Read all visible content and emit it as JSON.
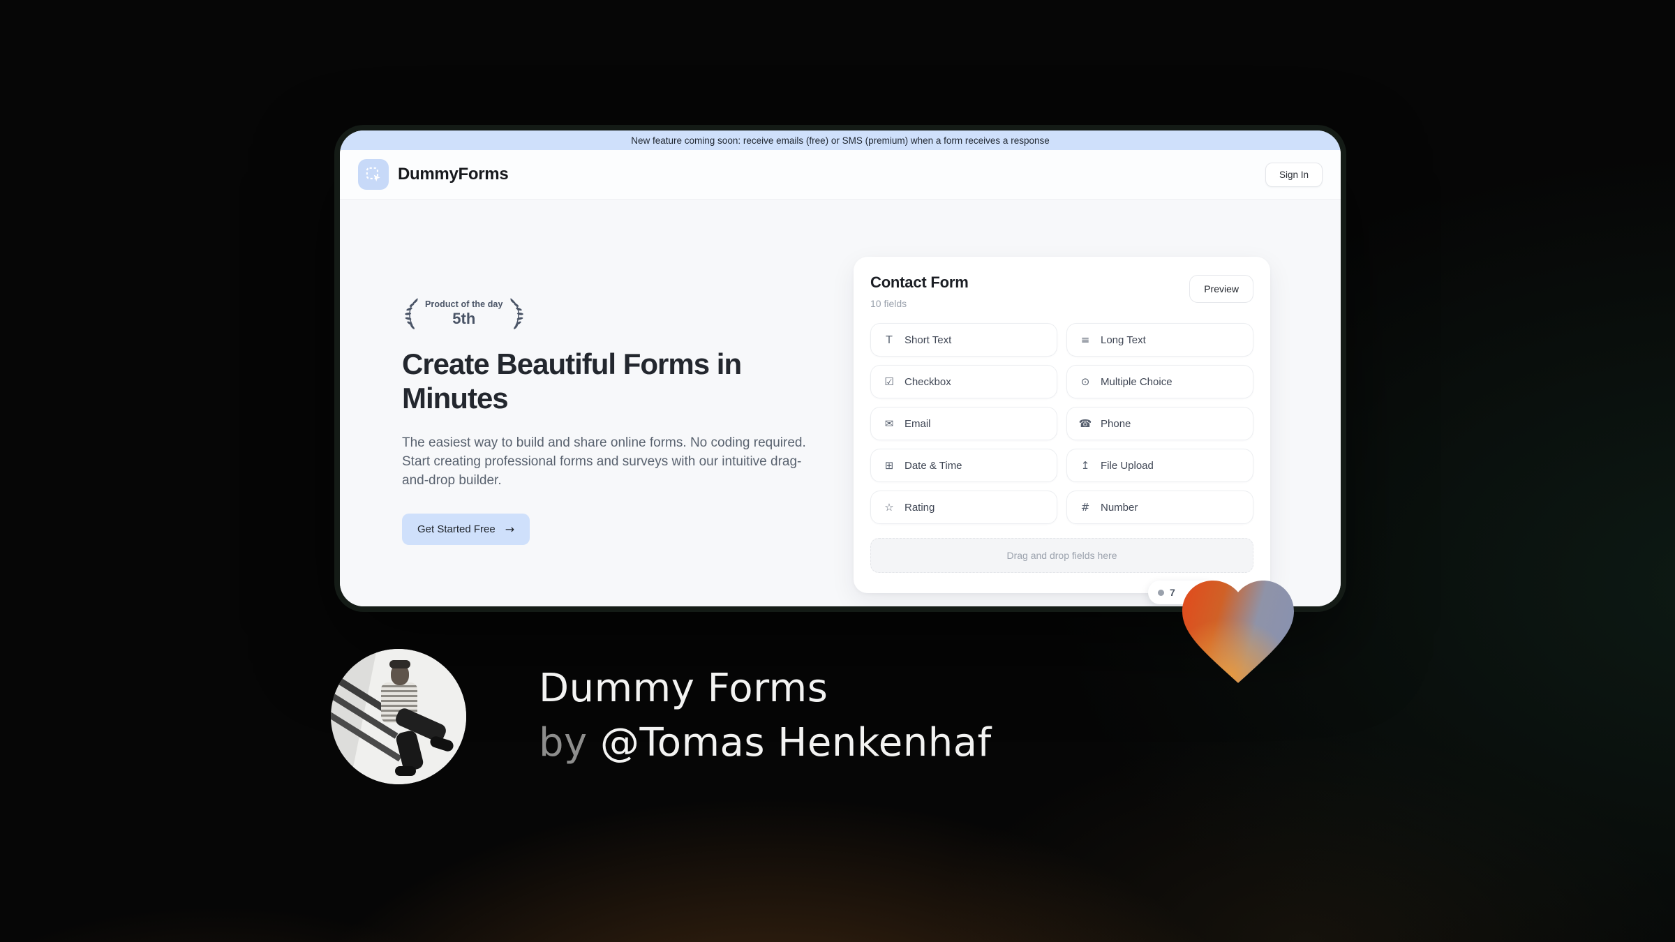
{
  "banner": {
    "text": "New feature coming soon: receive emails (free) or SMS (premium) when a form receives a response"
  },
  "header": {
    "brand": "DummyForms",
    "sign_in_label": "Sign In"
  },
  "hero": {
    "badge": {
      "line1": "Product of the day",
      "line2": "5th"
    },
    "title_lines": [
      "Create Beautiful Forms in",
      "Minutes"
    ],
    "paragraph": "The easiest way to build and share online forms. No coding required. Start creating professional forms and surveys with our intuitive drag-and-drop builder.",
    "cta_label": "Get Started Free",
    "cta_icon": "→"
  },
  "form_card": {
    "title": "Contact Form",
    "subtitle": "10 fields",
    "preview_label": "Preview",
    "fields": [
      {
        "label": "Short Text",
        "icon": "short-text-icon",
        "glyph": "T"
      },
      {
        "label": "Long Text",
        "icon": "long-text-icon",
        "glyph": "≡"
      },
      {
        "label": "Checkbox",
        "icon": "checkbox-icon",
        "glyph": "☑"
      },
      {
        "label": "Multiple Choice",
        "icon": "multiple-choice-icon",
        "glyph": "⊙"
      },
      {
        "label": "Email",
        "icon": "email-icon",
        "glyph": "✉"
      },
      {
        "label": "Phone",
        "icon": "phone-icon",
        "glyph": "☎"
      },
      {
        "label": "Date & Time",
        "icon": "date-time-icon",
        "glyph": "⊞"
      },
      {
        "label": "File Upload",
        "icon": "file-upload-icon",
        "glyph": "↥"
      },
      {
        "label": "Rating",
        "icon": "rating-icon",
        "glyph": "☆"
      },
      {
        "label": "Number",
        "icon": "number-icon",
        "glyph": "#"
      }
    ],
    "dropzone_text": "Drag and drop fields here",
    "vote_count": "7"
  },
  "credit": {
    "title": "Dummy Forms",
    "byline_prefix": "by",
    "byline_handle": "@Tomas Henkenhaf"
  },
  "colors": {
    "accent_blue": "#cfe0fb",
    "banner_blue": "#cfe0fb",
    "heart_orange": "#e2491c",
    "heart_amber": "#e9963c",
    "heart_slate": "#8b93ad",
    "window_bg": "#f7f8fa",
    "frame_ring": "#141b16"
  }
}
